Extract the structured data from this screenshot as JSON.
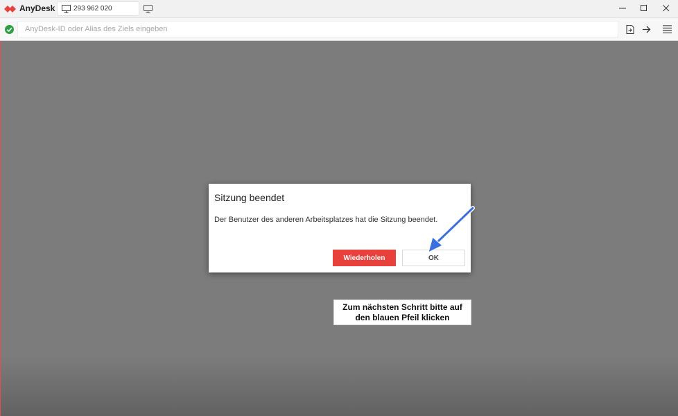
{
  "app": {
    "name": "AnyDesk",
    "session_tab_label": "293 962 020",
    "brand_color": "#e8413c"
  },
  "window_controls": {
    "minimize_icon": "minimize-icon",
    "maximize_icon": "maximize-icon",
    "close_icon": "close-icon"
  },
  "addressbar": {
    "status_icon": "connected-check-icon",
    "placeholder": "AnyDesk-ID oder Alias des Ziels eingeben",
    "value": "",
    "status_color": "#2ea043"
  },
  "dialog": {
    "title": "Sitzung beendet",
    "message": "Der Benutzer des anderen Arbeitsplatzes hat die Sitzung beendet.",
    "retry_label": "Wiederholen",
    "ok_label": "OK"
  },
  "annotation": {
    "line1": "Zum nächsten Schritt bitte auf",
    "line2": "den blauen  Pfeil klicken",
    "arrow_color": "#3b6fe0"
  }
}
